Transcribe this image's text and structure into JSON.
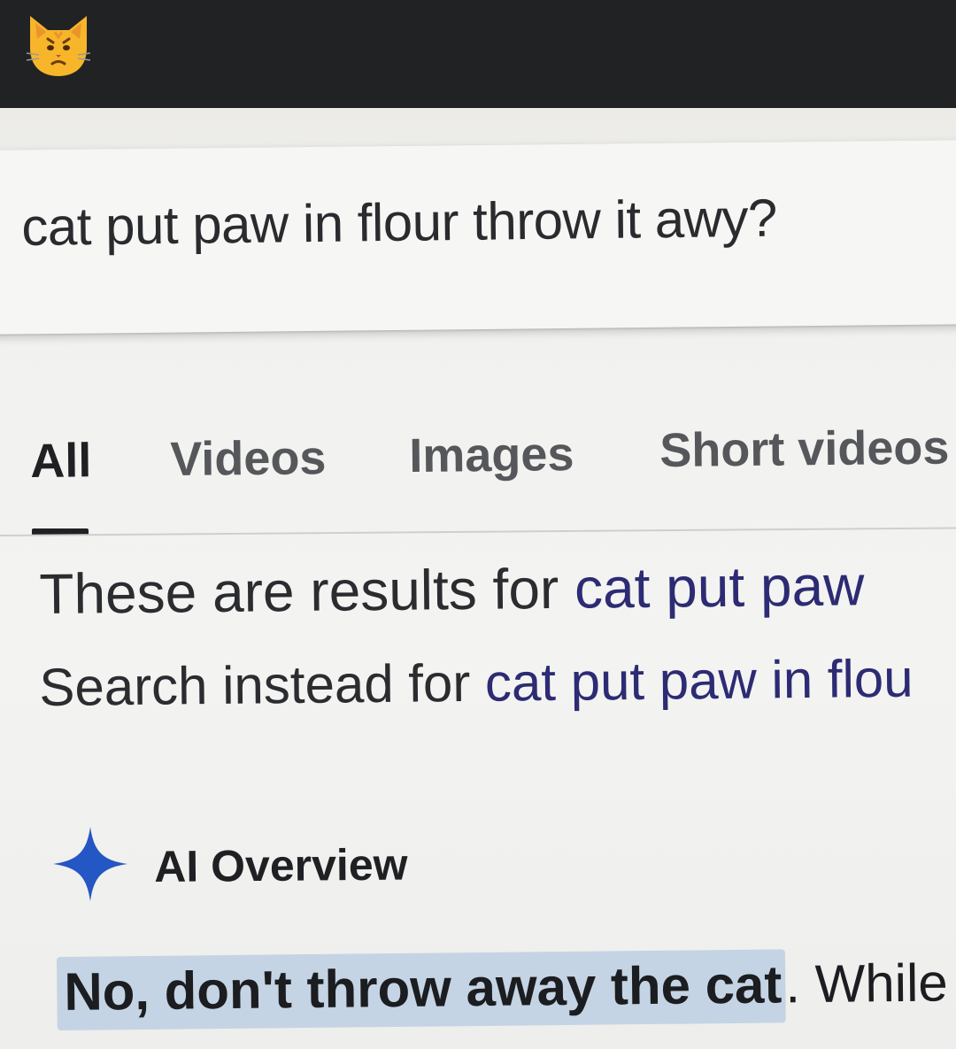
{
  "header": {
    "emoji": "😾",
    "emoji_icon": "pouting-cat-emoji-icon",
    "background_color": "#212224"
  },
  "search": {
    "query": "cat put paw in flour throw it awy?"
  },
  "tabs": [
    {
      "label": "All",
      "active": true
    },
    {
      "label": "Videos",
      "active": false
    },
    {
      "label": "Images",
      "active": false
    },
    {
      "label": "Short videos",
      "active": false
    }
  ],
  "spelling": {
    "results_prefix": "These are results for ",
    "results_link": "cat put paw",
    "instead_prefix": "Search instead for ",
    "instead_link": "cat put paw in flou"
  },
  "ai_overview": {
    "icon": "sparkle-icon",
    "title": "AI Overview",
    "highlight": "No, don't throw away the cat",
    "rest": ". While ",
    "accent_color": "#2456c4"
  }
}
